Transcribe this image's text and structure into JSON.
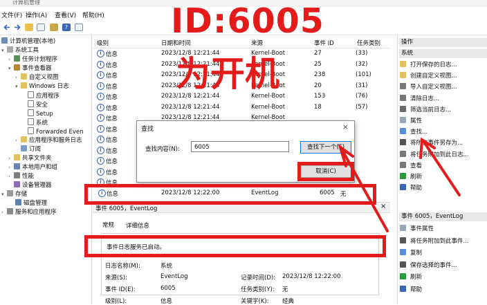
{
  "window": {
    "title": "计算机管理"
  },
  "menu": {
    "file": "文件(F)",
    "action": "操作(A)",
    "view": "查看(V)",
    "help": "帮助(H)"
  },
  "tree": {
    "items": [
      {
        "label": "计算机管理(本地)"
      },
      {
        "label": "系统工具"
      },
      {
        "label": "任务计划程序"
      },
      {
        "label": "事件查看器"
      },
      {
        "label": "自定义视图"
      },
      {
        "label": "Windows 日志"
      },
      {
        "label": "应用程序"
      },
      {
        "label": "安全"
      },
      {
        "label": "Setup"
      },
      {
        "label": "系统"
      },
      {
        "label": "Forwarded Even"
      },
      {
        "label": "应用程序和服务日志"
      },
      {
        "label": "订阅"
      },
      {
        "label": "共享文件夹"
      },
      {
        "label": "本地用户和组"
      },
      {
        "label": "性能"
      },
      {
        "label": "设备管理器"
      },
      {
        "label": "存储"
      },
      {
        "label": "磁盘管理"
      },
      {
        "label": "服务和应用程序"
      }
    ]
  },
  "events": {
    "headers": {
      "level": "级别",
      "datetime": "日期和时间",
      "source": "来源",
      "id": "事件 ID",
      "task": "任务类别"
    },
    "rows": [
      {
        "level": "信息",
        "datetime": "2023/12/8 12:21:44",
        "source": "Kernel-Boot",
        "id": "27",
        "task": "(33)"
      },
      {
        "level": "信息",
        "datetime": "2023/12/8 12:21:44",
        "source": "Kernel-Boot",
        "id": "25",
        "task": "(32)"
      },
      {
        "level": "信息",
        "datetime": "2023/12/8 12:21:44",
        "source": "Kernel-Boot",
        "id": "238",
        "task": "(101)"
      },
      {
        "level": "信息",
        "datetime": "2023/12/8 12:21:44",
        "source": "Kernel-Boot",
        "id": "20",
        "task": "(31)"
      },
      {
        "level": "信息",
        "datetime": "2023/12/8 12:21:44",
        "source": "Kernel-Boot",
        "id": "153",
        "task": "(76)"
      },
      {
        "level": "信息",
        "datetime": "2023/12/8 12:21:44",
        "source": "Kernel-Boot",
        "id": "18",
        "task": "(57)"
      },
      {
        "level": "信息",
        "datetime": "2023/12/8 12:21:44",
        "source": "Kernel-Boot",
        "id": "",
        "task": ""
      },
      {
        "level": "信息",
        "datetime": "",
        "source": "",
        "id": "",
        "task": ""
      },
      {
        "level": "信息",
        "datetime": "",
        "source": "",
        "id": "",
        "task": ""
      },
      {
        "level": "信息",
        "datetime": "",
        "source": "",
        "id": "",
        "task": ""
      },
      {
        "level": "信息",
        "datetime": "",
        "source": "",
        "id": "",
        "task": ""
      },
      {
        "level": "信息",
        "datetime": "",
        "source": "",
        "id": "",
        "task": ""
      },
      {
        "level": "信息",
        "datetime": "",
        "source": "",
        "id": "",
        "task": ""
      },
      {
        "level": "信息",
        "datetime": "",
        "source": "",
        "id": "",
        "task": ""
      }
    ],
    "selected": {
      "level": "信息",
      "datetime": "2023/12/8 12:22:00",
      "source": "EventLog",
      "id": "6005",
      "task": "无"
    }
  },
  "detail": {
    "title": "事件 6005，EventLog",
    "tabs": {
      "general": "常规",
      "details": "详细信息"
    },
    "message": "事件日志服务已启动。",
    "fields": {
      "log_name_label": "日志名称(M):",
      "log_name": "系统",
      "source_label": "来源(S):",
      "source": "EventLog",
      "recorded_label": "记录时间(D):",
      "recorded": "2023/12/8 12:22:00",
      "event_id_label": "事件 ID(E):",
      "event_id": "6005",
      "task_label": "任务类别(Y):",
      "task": "无",
      "level_label": "级别(L):",
      "level": "信息",
      "keywords_label": "关键字(K):",
      "keywords": "经典"
    }
  },
  "actions": {
    "header": "操作",
    "section1": "系统",
    "items1": [
      "打开保存的日志...",
      "创建自定义视图...",
      "导入自定义视图...",
      "清除日志...",
      "筛选当前日志...",
      "属性",
      "查找...",
      "将所有事件另存为...",
      "将任务附加到此日志...",
      "查看",
      "刷新",
      "帮助"
    ],
    "section2": "事件 6005，EventLog",
    "items2": [
      "事件属性",
      "将任务附加到此事件...",
      "复制",
      "保存选择的事件...",
      "刷新",
      "帮助"
    ]
  },
  "find_dialog": {
    "title": "查找",
    "label": "查找内容(N):",
    "value": "6005",
    "find_next": "查找下一个(F)",
    "cancel": "取消(C)",
    "close": "×"
  },
  "annotations": {
    "id_label": "ID:6005",
    "boot_label": "为开机",
    "color": "#e31b1b"
  }
}
